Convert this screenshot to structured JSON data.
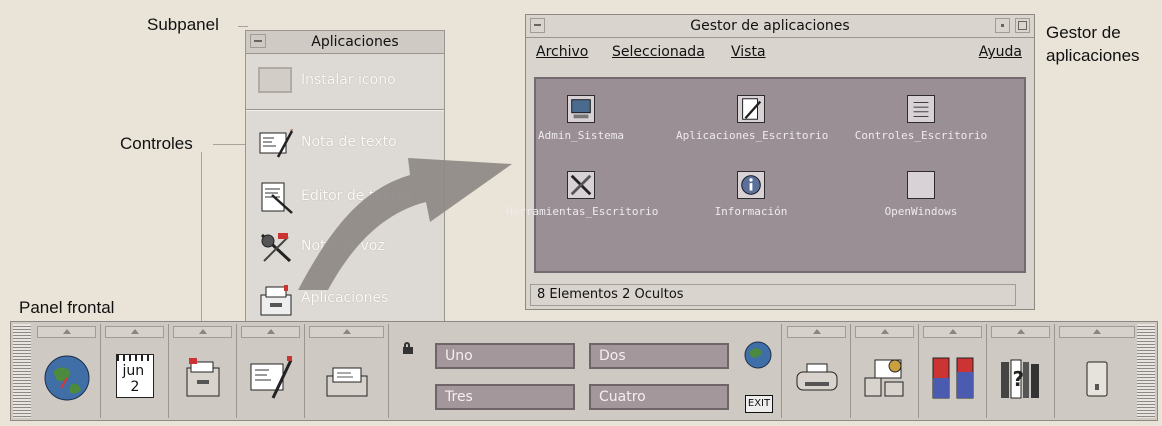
{
  "callouts": {
    "subpanel": "Subpanel",
    "controles": "Controles",
    "panel_frontal": "Panel frontal",
    "gestor_line1": "Gestor de",
    "gestor_line2": "aplicaciones"
  },
  "subpanel": {
    "title": "Aplicaciones",
    "install_label": "Instalar icono",
    "items": [
      {
        "label": "Nota de texto",
        "icon": "note-pen-icon"
      },
      {
        "label": "Editor de textos",
        "icon": "text-editor-icon"
      },
      {
        "label": "Nota de voz",
        "icon": "microphone-icon"
      },
      {
        "label": "Aplicaciones",
        "icon": "app-drawer-icon"
      }
    ]
  },
  "appmgr": {
    "title": "Gestor de aplicaciones",
    "menu": {
      "archivo": "Archivo",
      "seleccionada": "Seleccionada",
      "vista": "Vista",
      "ayuda": "Ayuda"
    },
    "groups": [
      {
        "label": "Admin_Sistema",
        "icon": "computer-icon"
      },
      {
        "label": "Aplicaciones_Escritorio",
        "icon": "pencil-pad-icon"
      },
      {
        "label": "Controles_Escritorio",
        "icon": "list-icon"
      },
      {
        "label": "Herramientas_Escritorio",
        "icon": "tools-icon"
      },
      {
        "label": "Información",
        "icon": "info-icon"
      },
      {
        "label": "OpenWindows",
        "icon": "window-icon"
      }
    ],
    "status": "8 Elementos 2 Ocultos"
  },
  "frontpanel": {
    "date": {
      "month": "jun",
      "day": "2"
    },
    "workspaces": [
      "Uno",
      "Dos",
      "Tres",
      "Cuatro"
    ],
    "exit_label": "EXIT"
  },
  "colors": {
    "arrow": "#8e8986",
    "workspace_button": "#a4979c",
    "icon_area": "#9a8f94"
  }
}
